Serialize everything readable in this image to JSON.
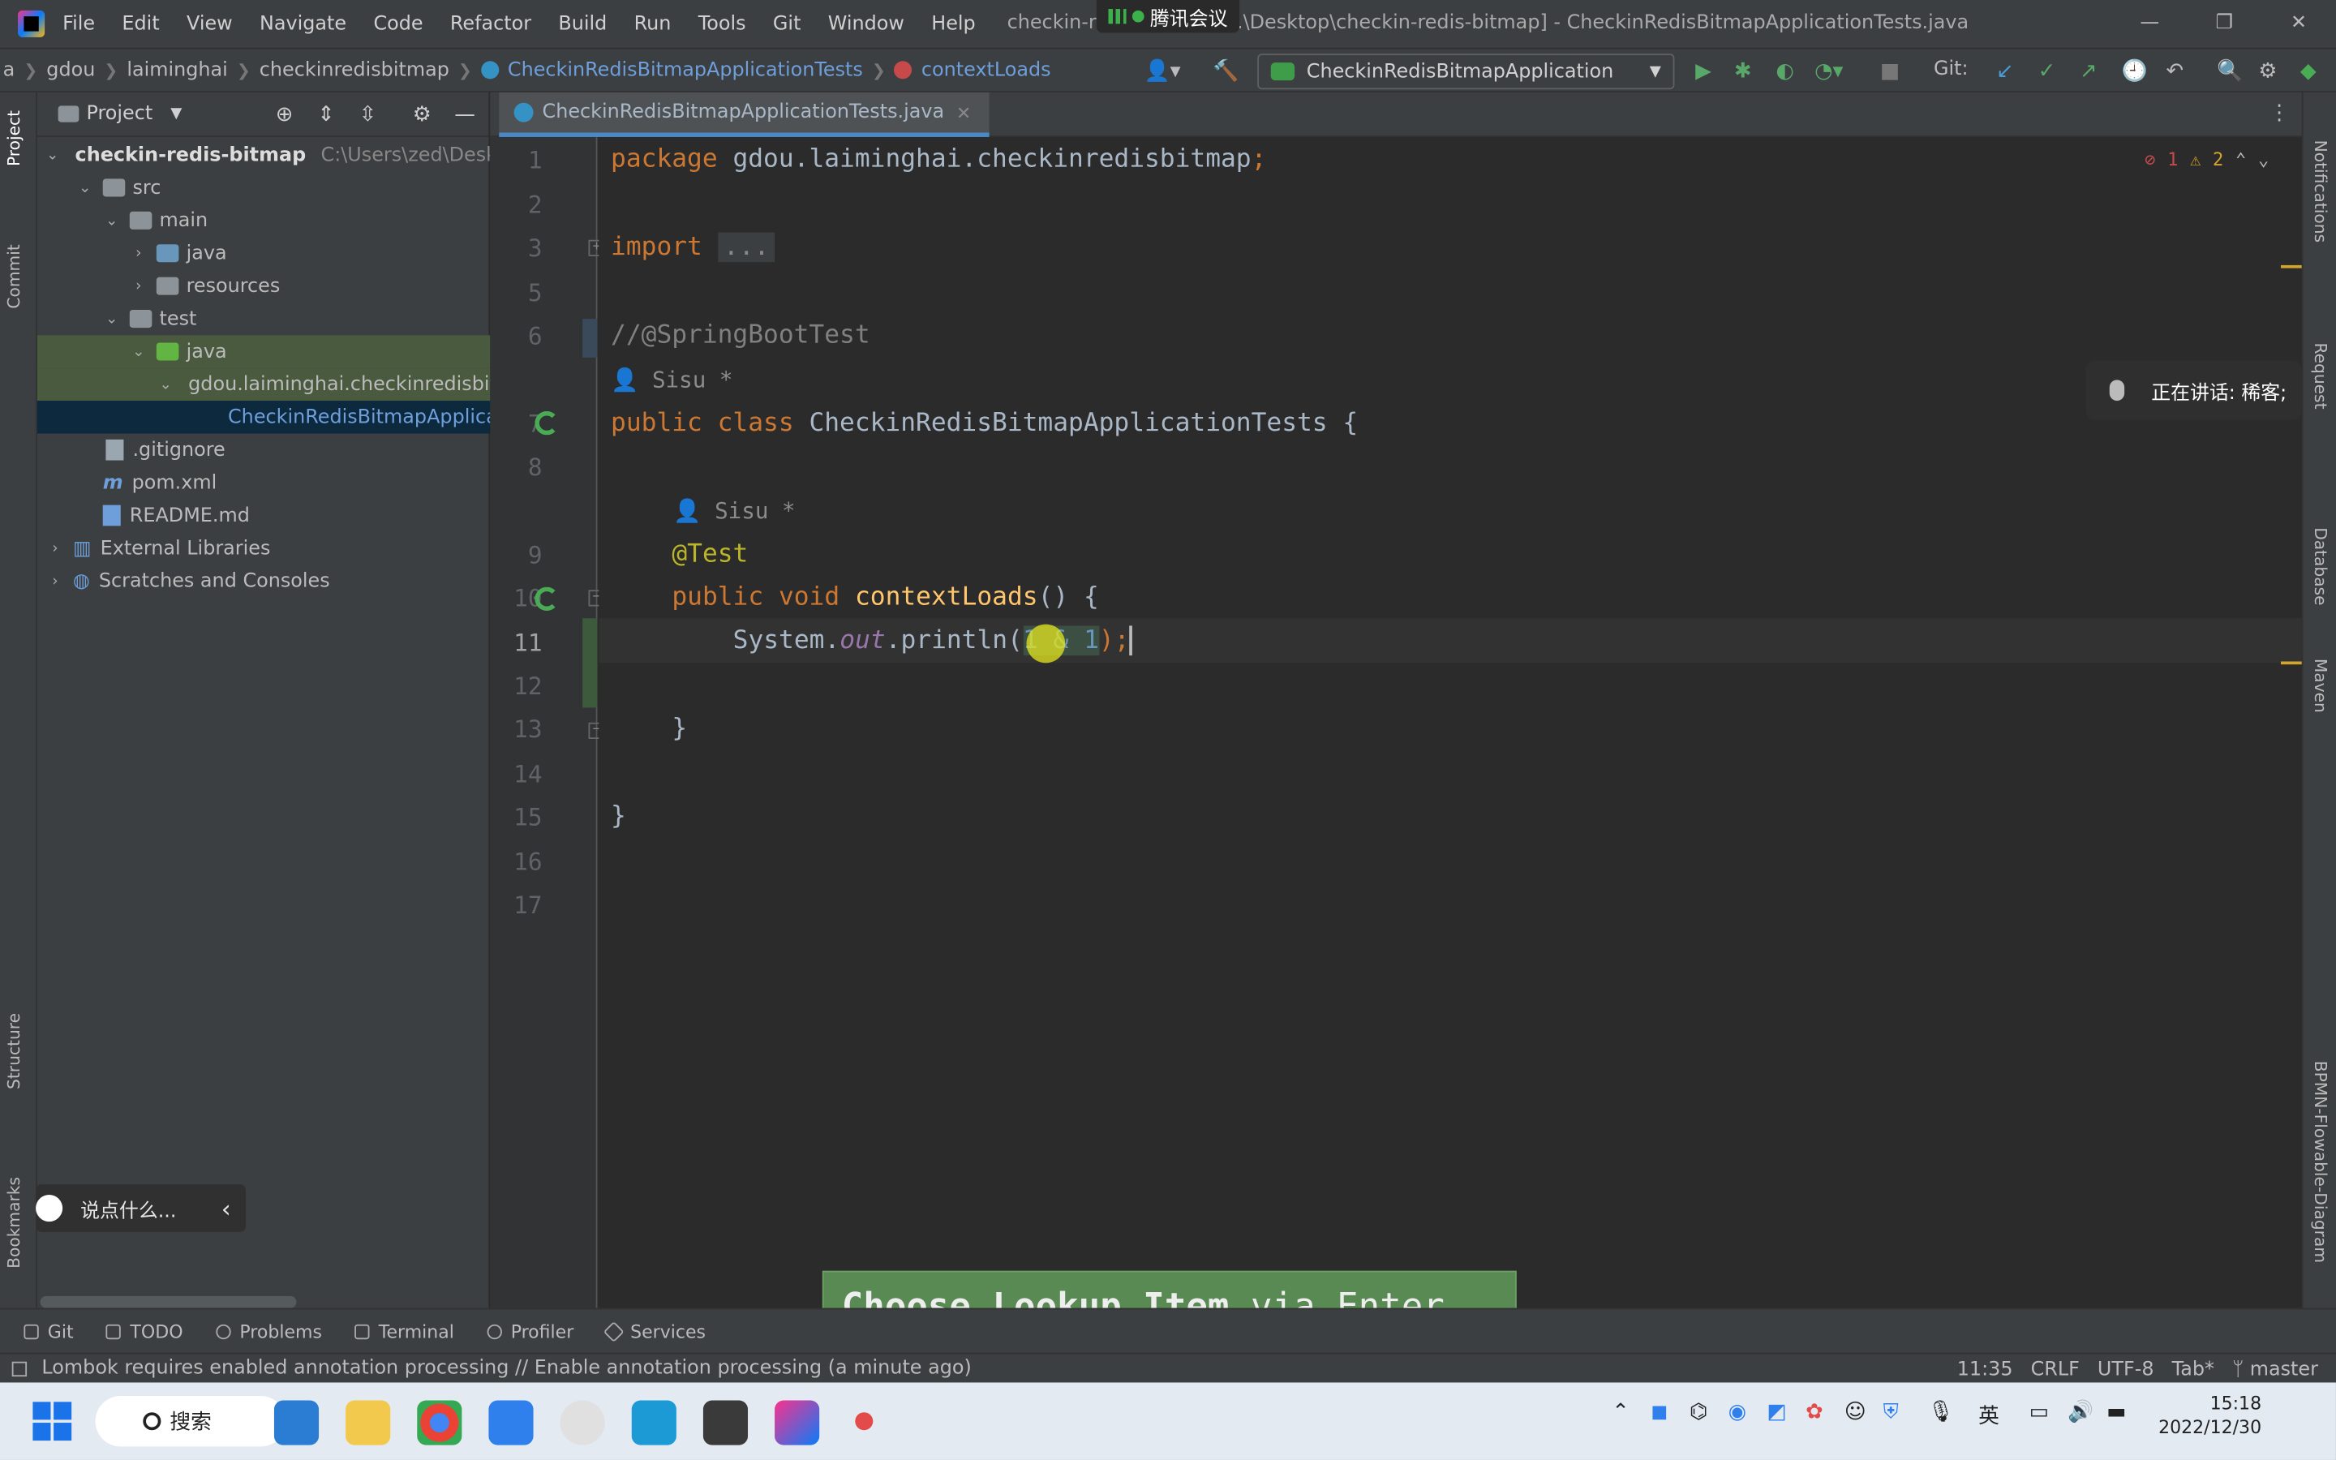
{
  "window": {
    "title": "checkin-redis-bitmap [...\\Desktop\\checkin-redis-bitmap] - CheckinRedisBitmapApplicationTests.java",
    "meeting_badge": "腾讯会议",
    "minimize": "—",
    "restore": "❐",
    "close": "✕"
  },
  "menu": [
    "File",
    "Edit",
    "View",
    "Navigate",
    "Code",
    "Refactor",
    "Build",
    "Run",
    "Tools",
    "Git",
    "Window",
    "Help"
  ],
  "breadcrumb": [
    "a",
    "gdou",
    "laiminghai",
    "checkinredisbitmap",
    "CheckinRedisBitmapApplicationTests",
    "contextLoads"
  ],
  "run_config": "CheckinRedisBitmapApplication",
  "git_label": "Git:",
  "left_tabs": {
    "project": "Project",
    "commit": "Commit",
    "structure": "Structure",
    "bookmarks": "Bookmarks"
  },
  "right_tabs": {
    "notifications": "Notifications",
    "request": "Request",
    "database": "Database",
    "maven": "Maven",
    "bpmn": "BPMN-Flowable-Diagram"
  },
  "project_panel": {
    "title": "Project",
    "tree": [
      {
        "label": "checkin-redis-bitmap",
        "path": "C:\\Users\\zed\\Desktop"
      },
      {
        "label": "src"
      },
      {
        "label": "main"
      },
      {
        "label": "java"
      },
      {
        "label": "resources"
      },
      {
        "label": "test"
      },
      {
        "label": "java"
      },
      {
        "label": "gdou.laiminghai.checkinredisbitmap"
      },
      {
        "label": "CheckinRedisBitmapApplicationTests"
      },
      {
        "label": ".gitignore"
      },
      {
        "label": "pom.xml"
      },
      {
        "label": "README.md"
      },
      {
        "label": "External Libraries"
      },
      {
        "label": "Scratches and Consoles"
      }
    ]
  },
  "editor": {
    "tab_label": "CheckinRedisBitmapApplicationTests.java",
    "errors": "1",
    "warnings": "2",
    "line_numbers": [
      "1",
      "2",
      "3",
      "5",
      "6",
      "7",
      "8",
      "9",
      "10",
      "11",
      "12",
      "13",
      "14",
      "15",
      "16",
      "17"
    ],
    "code": {
      "l1_kw": "package",
      "l1_rest": " gdou.laiminghai.checkinredisbitmap",
      "l1_semi": ";",
      "l3_kw": "import",
      "l3_fold": "...",
      "l6": "//@SpringBootTest",
      "hint_author": "Sisu *",
      "l7_kw": "public class",
      "l7_rest": " CheckinRedisBitmapApplicationTests {",
      "l9": "@Test",
      "l10_kw": "public void",
      "l10_fn": "contextLoads",
      "l10_rest": "() {",
      "l11_a": "System.",
      "l11_out": "out",
      "l11_b": ".println(",
      "l11_sel": "1 & 1",
      "l11_c": ");",
      "l13": "}",
      "l15": "}"
    }
  },
  "overlays": {
    "speaking": "正在讲话: 稀客;",
    "say_something": "说点什么...",
    "lookup_hint_bold": "Choose Lookup Item",
    "lookup_hint_rest": " via Enter"
  },
  "tool_windows": [
    "Git",
    "TODO",
    "Problems",
    "Terminal",
    "Profiler",
    "Services"
  ],
  "status": {
    "message": "Lombok requires enabled annotation processing // Enable annotation processing (a minute ago)",
    "position": "11:35",
    "line_sep": "CRLF",
    "encoding": "UTF-8",
    "indent": "Tab*",
    "branch": "master"
  },
  "taskbar": {
    "search": "搜索",
    "ime": "英",
    "time": "15:18",
    "date": "2022/12/30"
  },
  "colors": {
    "keyword": "#cc7832",
    "annotation": "#bbb529",
    "function": "#ffc66d",
    "comment": "#808080",
    "accent": "#4a88c7"
  }
}
